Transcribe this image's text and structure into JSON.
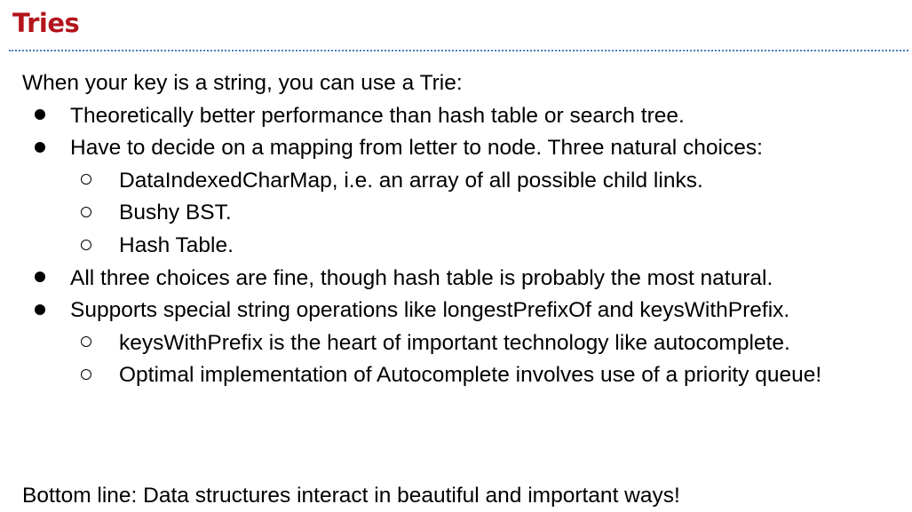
{
  "slide": {
    "title": "Tries",
    "intro": "When your key is a string, you can use a Trie:",
    "bullets": [
      {
        "text": "Theoretically better performance than hash table or search tree.",
        "sub": []
      },
      {
        "text": "Have to decide on a mapping from letter to node. Three natural choices:",
        "sub": [
          "DataIndexedCharMap, i.e. an array of all possible child links.",
          "Bushy BST.",
          "Hash Table."
        ]
      },
      {
        "text": "All three choices are fine, though hash table is probably the most natural.",
        "sub": []
      },
      {
        "text": "Supports special string operations like longestPrefixOf and keysWithPrefix.",
        "sub": [
          "keysWithPrefix is the heart of important technology like autocomplete.",
          "Optimal implementation of Autocomplete involves use of a priority queue!"
        ]
      }
    ],
    "bottom_line": "Bottom line: Data structures interact in beautiful and important ways!",
    "colors": {
      "title": "#b3131b",
      "rule": "#4a7ebb",
      "text": "#000000"
    }
  }
}
